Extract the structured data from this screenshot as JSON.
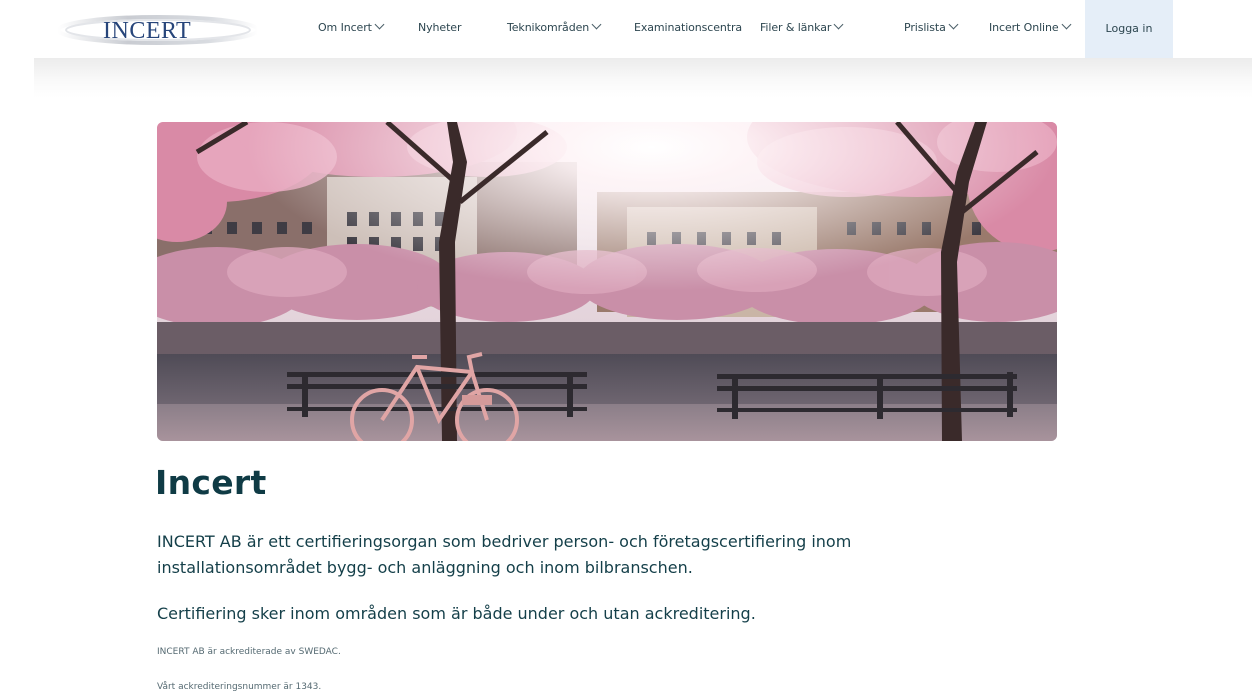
{
  "header": {
    "logo_text": "INCERT",
    "nav": [
      {
        "label": "Om Incert",
        "dropdown": true
      },
      {
        "label": "Nyheter",
        "dropdown": false
      },
      {
        "label": "Teknikområden",
        "dropdown": true
      },
      {
        "label": "Examinationscentra",
        "dropdown": false
      },
      {
        "label": "Filer & länkar",
        "dropdown": true
      },
      {
        "label": "Prislista",
        "dropdown": true
      },
      {
        "label": "Incert Online",
        "dropdown": true
      }
    ],
    "login_label": "Logga in",
    "login_bg": "#e5eef8"
  },
  "hero": {
    "icon": "cherry-blossom-park-photo"
  },
  "main": {
    "title": "Incert",
    "lead": "INCERT AB är ett certifieringsorgan som bedriver person- och företagscertifiering inom installationsområdet bygg- och anläggning och inom bilbranschen.",
    "lead2": "Certifiering sker inom områden som är både under och utan ackreditering.",
    "note1": "INCERT AB är ackrediterade av SWEDAC.",
    "note2": "Vårt ackrediteringsnummer är 1343."
  },
  "colors": {
    "text_primary": "#0f3b45",
    "login_highlight": "#e5eef8"
  }
}
